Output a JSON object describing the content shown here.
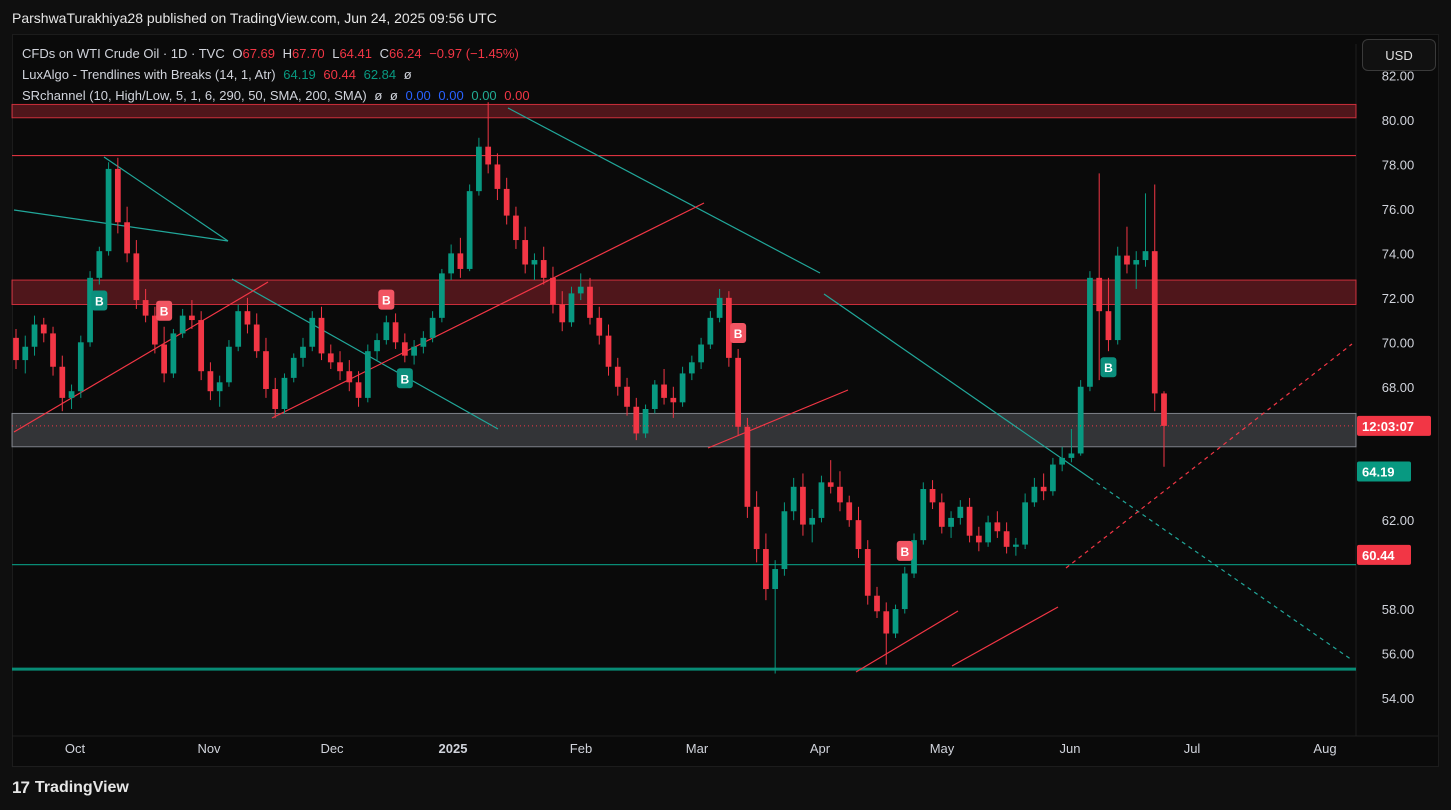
{
  "header": {
    "publish_line": "ParshwaTurakhiya28 published on TradingView.com, Jun 24, 2025 09:56 UTC"
  },
  "legend": {
    "symbol": "CFDs on WTI Crude Oil · 1D · TVC",
    "o_label": "O",
    "o_val": "67.69",
    "h_label": "H",
    "h_val": "67.70",
    "l_label": "L",
    "l_val": "64.41",
    "c_label": "C",
    "c_val": "66.24",
    "change": "−0.97 (−1.45%)",
    "luxalgo_name": "LuxAlgo - Trendlines with Breaks (14, 1, Atr)",
    "luxalgo_v1": "64.19",
    "luxalgo_v2": "60.44",
    "luxalgo_v3": "62.84",
    "luxalgo_v4": "ø",
    "srchannel_name": "SRchannel (10, High/Low, 5, 1, 6, 290, 50, SMA, 200, SMA)",
    "sr_v1": "ø",
    "sr_v2": "ø",
    "sr_v3": "0.00",
    "sr_v4": "0.00",
    "sr_v5": "0.00",
    "sr_v6": "0.00"
  },
  "currency_button": "USD",
  "footer": {
    "brand": "TradingView",
    "logo": "17"
  },
  "chart_data": {
    "type": "candlestick",
    "y_axis": {
      "min": 53,
      "max": 82.5,
      "ticks": [
        "82.00",
        "80.00",
        "78.00",
        "76.00",
        "74.00",
        "72.00",
        "70.00",
        "68.00",
        "62.00",
        "58.00",
        "56.00",
        "54.00"
      ]
    },
    "x_axis": {
      "labels": [
        "Oct",
        "Nov",
        "Dec",
        "2025",
        "Feb",
        "Mar",
        "Apr",
        "May",
        "Jun",
        "Jul",
        "Aug"
      ]
    },
    "price_labels": [
      {
        "text": "12:03:07",
        "value": 66.24,
        "color": "#f23645"
      },
      {
        "text": "64.19",
        "value": 64.19,
        "color": "#089981"
      },
      {
        "text": "60.44",
        "value": 60.44,
        "color": "#f23645"
      }
    ],
    "candles": [
      [
        70.2,
        70.6,
        68.8,
        69.2
      ],
      [
        69.2,
        70.3,
        68.6,
        69.8
      ],
      [
        69.8,
        71.2,
        69.4,
        70.8
      ],
      [
        70.8,
        71.1,
        70.0,
        70.4
      ],
      [
        70.4,
        70.7,
        68.5,
        68.9
      ],
      [
        68.9,
        69.4,
        66.9,
        67.5
      ],
      [
        67.5,
        68.1,
        67.0,
        67.8
      ],
      [
        67.8,
        70.3,
        67.5,
        70.0
      ],
      [
        70.0,
        73.2,
        69.8,
        72.9
      ],
      [
        72.9,
        74.3,
        72.6,
        74.1
      ],
      [
        74.1,
        78.1,
        73.9,
        77.8
      ],
      [
        77.8,
        78.3,
        74.9,
        75.4
      ],
      [
        75.4,
        76.1,
        73.6,
        74.0
      ],
      [
        74.0,
        74.6,
        71.5,
        71.9
      ],
      [
        71.9,
        72.4,
        70.9,
        71.2
      ],
      [
        71.2,
        71.6,
        69.5,
        69.9
      ],
      [
        69.9,
        70.7,
        68.2,
        68.6
      ],
      [
        68.6,
        70.6,
        68.4,
        70.4
      ],
      [
        70.4,
        71.5,
        70.2,
        71.2
      ],
      [
        71.2,
        71.9,
        70.6,
        71.0
      ],
      [
        71.0,
        71.4,
        68.3,
        68.7
      ],
      [
        68.7,
        69.1,
        67.4,
        67.8
      ],
      [
        67.8,
        68.5,
        67.1,
        68.2
      ],
      [
        68.2,
        70.1,
        68.0,
        69.8
      ],
      [
        69.8,
        71.7,
        69.6,
        71.4
      ],
      [
        71.4,
        72.0,
        70.4,
        70.8
      ],
      [
        70.8,
        71.3,
        69.3,
        69.6
      ],
      [
        69.6,
        70.2,
        67.5,
        67.9
      ],
      [
        67.9,
        68.4,
        66.6,
        67.0
      ],
      [
        67.0,
        68.6,
        66.8,
        68.4
      ],
      [
        68.4,
        69.5,
        68.2,
        69.3
      ],
      [
        69.3,
        70.2,
        68.9,
        69.8
      ],
      [
        69.8,
        71.4,
        69.6,
        71.1
      ],
      [
        71.1,
        71.6,
        69.2,
        69.5
      ],
      [
        69.5,
        69.9,
        68.8,
        69.1
      ],
      [
        69.1,
        69.6,
        68.3,
        68.7
      ],
      [
        68.7,
        69.2,
        67.8,
        68.2
      ],
      [
        68.2,
        68.7,
        67.1,
        67.5
      ],
      [
        67.5,
        69.9,
        67.3,
        69.6
      ],
      [
        69.6,
        70.4,
        69.2,
        70.1
      ],
      [
        70.1,
        71.2,
        69.9,
        70.9
      ],
      [
        70.9,
        71.3,
        69.7,
        70.0
      ],
      [
        70.0,
        70.4,
        69.1,
        69.4
      ],
      [
        69.4,
        70.1,
        69.0,
        69.8
      ],
      [
        69.8,
        70.5,
        69.5,
        70.2
      ],
      [
        70.2,
        71.4,
        70.0,
        71.1
      ],
      [
        71.1,
        73.3,
        70.9,
        73.1
      ],
      [
        73.1,
        74.4,
        72.8,
        74.0
      ],
      [
        74.0,
        74.7,
        72.9,
        73.3
      ],
      [
        73.3,
        77.1,
        73.2,
        76.8
      ],
      [
        76.8,
        79.2,
        76.6,
        78.8
      ],
      [
        78.8,
        80.8,
        77.6,
        78.0
      ],
      [
        78.0,
        78.5,
        76.4,
        76.9
      ],
      [
        76.9,
        77.4,
        75.3,
        75.7
      ],
      [
        75.7,
        76.1,
        74.2,
        74.6
      ],
      [
        74.6,
        75.2,
        73.1,
        73.5
      ],
      [
        73.5,
        74.0,
        72.8,
        73.7
      ],
      [
        73.7,
        74.3,
        72.6,
        72.9
      ],
      [
        72.9,
        73.4,
        71.3,
        71.7
      ],
      [
        71.7,
        72.3,
        70.5,
        70.9
      ],
      [
        70.9,
        72.5,
        70.7,
        72.2
      ],
      [
        72.2,
        73.1,
        71.9,
        72.5
      ],
      [
        72.5,
        72.9,
        70.8,
        71.1
      ],
      [
        71.1,
        71.6,
        69.9,
        70.3
      ],
      [
        70.3,
        70.8,
        68.5,
        68.9
      ],
      [
        68.9,
        69.3,
        67.6,
        68.0
      ],
      [
        68.0,
        68.4,
        66.7,
        67.1
      ],
      [
        67.1,
        67.5,
        65.6,
        65.9
      ],
      [
        65.9,
        67.2,
        65.7,
        67.0
      ],
      [
        67.0,
        68.3,
        66.8,
        68.1
      ],
      [
        68.1,
        68.8,
        67.2,
        67.5
      ],
      [
        67.5,
        68.0,
        66.6,
        67.3
      ],
      [
        67.3,
        68.9,
        67.1,
        68.6
      ],
      [
        68.6,
        69.4,
        68.3,
        69.1
      ],
      [
        69.1,
        70.2,
        68.8,
        69.9
      ],
      [
        69.9,
        71.4,
        69.7,
        71.1
      ],
      [
        71.1,
        72.4,
        70.9,
        72.0
      ],
      [
        72.0,
        72.3,
        68.9,
        69.3
      ],
      [
        69.3,
        69.7,
        65.8,
        66.2
      ],
      [
        66.2,
        66.6,
        62.1,
        62.6
      ],
      [
        62.6,
        63.3,
        60.1,
        60.7
      ],
      [
        60.7,
        61.4,
        58.4,
        58.9
      ],
      [
        58.9,
        60.2,
        55.1,
        59.8
      ],
      [
        59.8,
        62.8,
        59.5,
        62.4
      ],
      [
        62.4,
        63.9,
        62.0,
        63.5
      ],
      [
        63.5,
        64.1,
        61.3,
        61.8
      ],
      [
        61.8,
        62.5,
        61.0,
        62.1
      ],
      [
        62.1,
        64.0,
        61.9,
        63.7
      ],
      [
        63.7,
        64.7,
        63.2,
        63.5
      ],
      [
        63.5,
        64.2,
        62.4,
        62.8
      ],
      [
        62.8,
        63.1,
        61.7,
        62.0
      ],
      [
        62.0,
        62.6,
        60.3,
        60.7
      ],
      [
        60.7,
        61.1,
        58.2,
        58.6
      ],
      [
        58.6,
        59.0,
        57.6,
        57.9
      ],
      [
        57.9,
        58.3,
        55.5,
        56.9
      ],
      [
        56.9,
        58.2,
        56.7,
        58.0
      ],
      [
        58.0,
        59.9,
        57.8,
        59.6
      ],
      [
        59.6,
        61.4,
        59.4,
        61.1
      ],
      [
        61.1,
        63.7,
        60.9,
        63.4
      ],
      [
        63.4,
        63.8,
        62.5,
        62.8
      ],
      [
        62.8,
        63.2,
        61.4,
        61.7
      ],
      [
        61.7,
        62.4,
        61.2,
        62.1
      ],
      [
        62.1,
        62.9,
        61.8,
        62.6
      ],
      [
        62.6,
        63.0,
        61.0,
        61.3
      ],
      [
        61.3,
        61.7,
        60.6,
        61.0
      ],
      [
        61.0,
        62.2,
        60.8,
        61.9
      ],
      [
        61.9,
        62.4,
        61.2,
        61.5
      ],
      [
        61.5,
        61.9,
        60.5,
        60.8
      ],
      [
        60.8,
        61.2,
        60.4,
        60.9
      ],
      [
        60.9,
        63.2,
        60.7,
        62.8
      ],
      [
        62.8,
        63.9,
        62.6,
        63.5
      ],
      [
        63.5,
        64.1,
        62.9,
        63.3
      ],
      [
        63.3,
        64.8,
        63.1,
        64.5
      ],
      [
        64.5,
        65.3,
        64.2,
        64.8
      ],
      [
        64.8,
        66.1,
        64.6,
        65.0
      ],
      [
        65.0,
        68.3,
        64.9,
        68.0
      ],
      [
        68.0,
        73.2,
        67.8,
        72.9
      ],
      [
        72.9,
        77.6,
        68.3,
        71.4
      ],
      [
        71.4,
        72.9,
        69.6,
        70.1
      ],
      [
        70.1,
        74.3,
        69.9,
        73.9
      ],
      [
        73.9,
        75.2,
        73.1,
        73.5
      ],
      [
        73.5,
        74.1,
        72.4,
        73.7
      ],
      [
        73.7,
        76.7,
        73.4,
        74.1
      ],
      [
        74.1,
        77.1,
        66.9,
        67.7
      ],
      [
        67.7,
        67.8,
        64.4,
        66.24
      ]
    ],
    "resistance_zones": [
      {
        "from": 80.1,
        "to": 80.7,
        "color": "#f23645"
      },
      {
        "from": 71.7,
        "to": 72.8,
        "color": "#f23645"
      },
      {
        "from": 65.3,
        "to": 66.8,
        "color": "#9598a1"
      }
    ],
    "horizontal_lines": [
      {
        "value": 78.4,
        "color": "#f23645"
      },
      {
        "value": 60.0,
        "color": "#089981"
      },
      {
        "value": 55.3,
        "color": "#089981"
      }
    ],
    "signals": [
      {
        "label": "B",
        "index": 9,
        "side": "buy"
      },
      {
        "label": "B",
        "index": 16,
        "side": "sell"
      },
      {
        "label": "B",
        "index": 40,
        "side": "sell"
      },
      {
        "label": "B",
        "index": 42,
        "side": "buy"
      },
      {
        "label": "B",
        "index": 78,
        "side": "sell"
      },
      {
        "label": "B",
        "index": 96,
        "side": "sell"
      },
      {
        "label": "B",
        "index": 118,
        "side": "buy"
      }
    ]
  }
}
